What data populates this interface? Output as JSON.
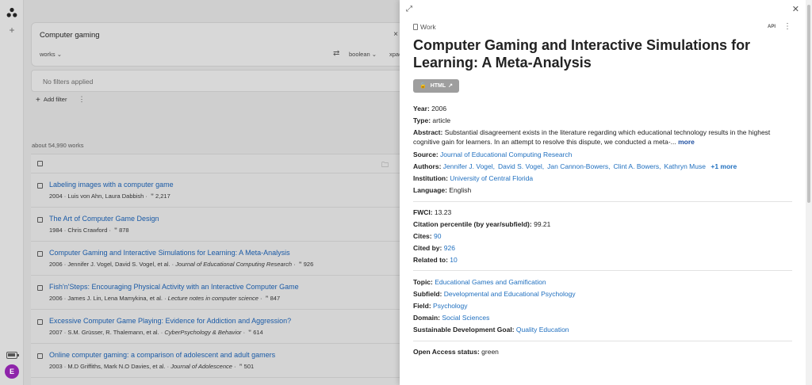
{
  "rail": {
    "avatar_letter": "E",
    "plus": "+"
  },
  "search": {
    "query": "Computer gaming",
    "entity": "works",
    "mode": "boolean",
    "extra": "xpac",
    "clear": "×"
  },
  "filters": {
    "none": "No filters applied",
    "add": "Add filter"
  },
  "count_text": "about 54,990 works",
  "results": [
    {
      "title": "Labeling images with a computer game",
      "meta": "2004 · Luis von Ahn, Laura Dabbish ·",
      "journal": "",
      "cites": "2,217"
    },
    {
      "title": "The Art of Computer Game Design",
      "meta": "1984 · Chris Crawford ·",
      "journal": "",
      "cites": "878"
    },
    {
      "title": "Computer Gaming and Interactive Simulations for Learning: A Meta-Analysis",
      "meta": "2006 · Jennifer J. Vogel, David S. Vogel, et al. ·",
      "journal": "Journal of Educational Computing Research",
      "cites": "926"
    },
    {
      "title": "Fish'n'Steps: Encouraging Physical Activity with an Interactive Computer Game",
      "meta": "2006 · James J. Lin, Lena Mamykina, et al. ·",
      "journal": "Lecture notes in computer science",
      "cites": "847"
    },
    {
      "title": "Excessive Computer Game Playing: Evidence for Addiction and Aggression?",
      "meta": "2007 · S.M. Grüsser, R. Thalemann, et al. ·",
      "journal": "CyberPsychology & Behavior",
      "cites": "614"
    },
    {
      "title": "Online computer gaming: a comparison of adolescent and adult gamers",
      "meta": "2003 · M.D Griffiths, Mark N.O Davies, et al. ·",
      "journal": "Journal of Adolescence",
      "cites": "501"
    }
  ],
  "panel": {
    "kind": "Work",
    "api": "API",
    "title": "Computer Gaming and Interactive Simulations for Learning: A Meta-Analysis",
    "oa_button": "HTML",
    "year_label": "Year:",
    "year": "2006",
    "type_label": "Type:",
    "type": "article",
    "abstract_label": "Abstract:",
    "abstract": "Substantial disagreement exists in the literature regarding which educational technology results in the highest cognitive gain for learners. In an attempt to resolve this dispute, we conducted a meta-...",
    "abstract_more": "more",
    "source_label": "Source:",
    "source": "Journal of Educational Computing Research",
    "authors_label": "Authors:",
    "authors": [
      "Jennifer J. Vogel,",
      "David S. Vogel,",
      "Jan Cannon-Bowers,",
      "Clint A. Bowers,",
      "Kathryn Muse"
    ],
    "authors_more": "+1 more",
    "institution_label": "Institution:",
    "institution": "University of Central Florida",
    "language_label": "Language:",
    "language": "English",
    "fwci_label": "FWCI:",
    "fwci": "13.23",
    "percentile_label": "Citation percentile (by year/subfield):",
    "percentile": "99.21",
    "cites_label": "Cites:",
    "cites": "90",
    "citedby_label": "Cited by:",
    "citedby": "926",
    "related_label": "Related to:",
    "related": "10",
    "topic_label": "Topic:",
    "topic": "Educational Games and Gamification",
    "subfield_label": "Subfield:",
    "subfield": "Developmental and Educational Psychology",
    "field_label": "Field:",
    "field": "Psychology",
    "domain_label": "Domain:",
    "domain": "Social Sciences",
    "sdg_label": "Sustainable Development Goal:",
    "sdg": "Quality Education",
    "oa_status_label": "Open Access status:",
    "oa_status": "green"
  },
  "colors": {
    "link": "#1f6fbf",
    "avatar": "#8e24aa",
    "oa_button": "#9e9e9e"
  }
}
